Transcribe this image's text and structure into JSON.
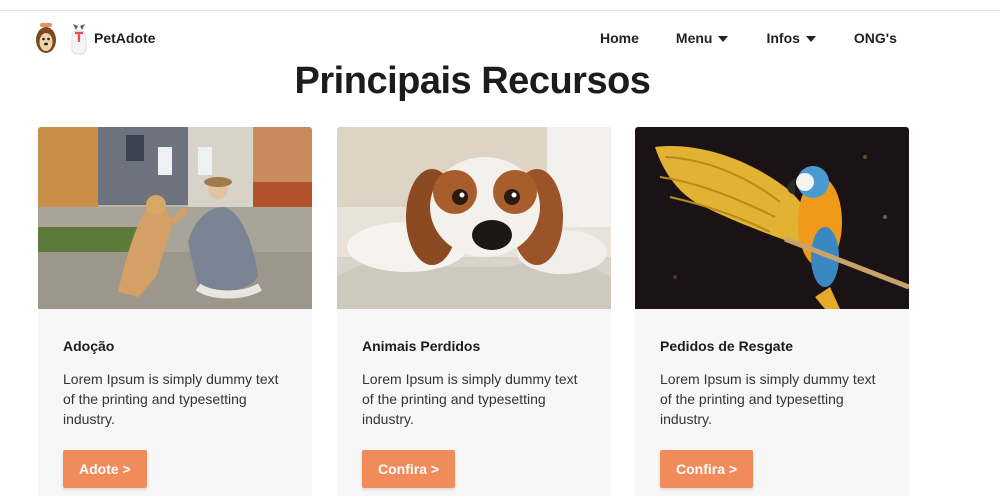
{
  "brand": {
    "name": "PetAdote"
  },
  "nav": {
    "home": "Home",
    "menu": "Menu",
    "infos": "Infos",
    "ongs": "ONG's"
  },
  "section": {
    "title": "Principais Recursos"
  },
  "cards": [
    {
      "title": "Adoção",
      "text": "Lorem Ipsum is simply dummy text of the printing and typesetting industry.",
      "button": "Adote >",
      "image": "woman-high-five-dog-photo"
    },
    {
      "title": "Animais Perdidos",
      "text": "Lorem Ipsum is simply dummy text of the printing and typesetting industry.",
      "button": "Confira >",
      "image": "spaniel-puppy-lying-photo"
    },
    {
      "title": "Pedidos de Resgate",
      "text": "Lorem Ipsum is simply dummy text of the printing and typesetting industry.",
      "button": "Confira >",
      "image": "macaw-parrot-photo"
    }
  ],
  "colors": {
    "accent": "#f28b5a",
    "card_bg": "#f7f7f7",
    "text": "#1f1f1f"
  }
}
